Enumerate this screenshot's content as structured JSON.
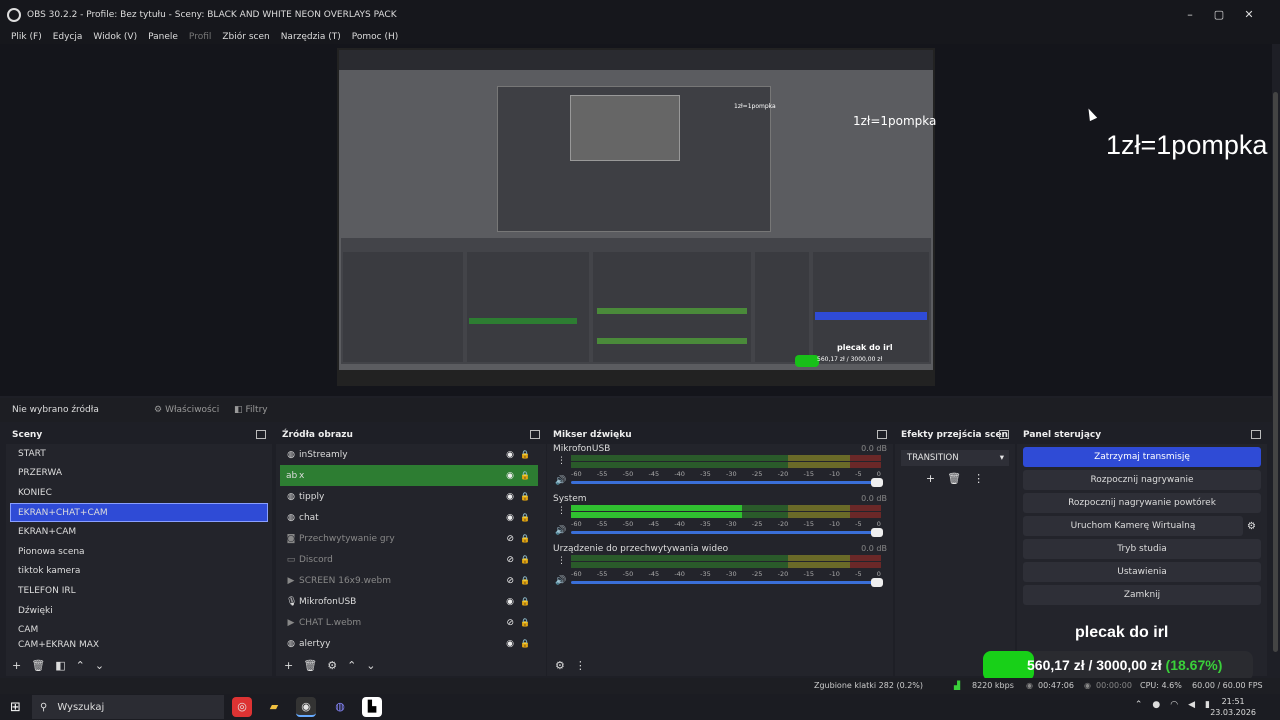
{
  "window": {
    "title": "OBS 30.2.2 - Profile: Bez tytułu - Sceny: BLACK AND WHITE NEON OVERLAYS PACK"
  },
  "menu": [
    "Plik (F)",
    "Edycja",
    "Widok (V)",
    "Panele",
    "Profil",
    "Zbiór scen",
    "Narzędzia (T)",
    "Pomoc (H)"
  ],
  "overlay": {
    "pompka": "1zł=1pompka",
    "plecak": "plecak do irl",
    "goal_amount": "560,17 zł / 3000,00 zł",
    "goal_pct": "(18.67%)",
    "goal_progress": 0.1867
  },
  "source_bar": {
    "no_source": "Nie wybrano źródła",
    "properties": "Właściwości",
    "filters": "Filtry"
  },
  "scenes": {
    "title": "Sceny",
    "items": [
      "START",
      "PRZERWA",
      "KONIEC",
      "EKRAN+CHAT+CAM",
      "EKRAN+CAM",
      "Pionowa scena",
      "tiktok kamera",
      "TELEFON IRL",
      "Dźwięki",
      "CAM",
      "CAM+EKRAN MAX"
    ],
    "selected": "EKRAN+CHAT+CAM"
  },
  "sources": {
    "title": "Źródła obrazu",
    "items": [
      {
        "name": "inStreamly",
        "icon": "globe-icon",
        "visible": true
      },
      {
        "name": "x",
        "icon": "text-icon",
        "visible": true,
        "selected": true
      },
      {
        "name": "tipply",
        "icon": "globe-icon",
        "visible": true
      },
      {
        "name": "chat",
        "icon": "globe-icon",
        "visible": true
      },
      {
        "name": "Przechwytywanie gry",
        "icon": "gamepad-icon",
        "visible": false
      },
      {
        "name": "Discord",
        "icon": "window-icon",
        "visible": false
      },
      {
        "name": "SCREEN 16x9.webm",
        "icon": "play-icon",
        "visible": false
      },
      {
        "name": "MikrofonUSB",
        "icon": "mic-icon",
        "visible": true
      },
      {
        "name": "CHAT L.webm",
        "icon": "play-icon",
        "visible": false
      },
      {
        "name": "alertyy",
        "icon": "globe-icon",
        "visible": true
      }
    ]
  },
  "mixer": {
    "title": "Mikser dźwięku",
    "scale": [
      "-60",
      "-55",
      "-50",
      "-45",
      "-40",
      "-35",
      "-30",
      "-25",
      "-20",
      "-15",
      "-10",
      "-5",
      "0"
    ],
    "channels": [
      {
        "name": "MikrofonUSB",
        "db": "0.0 dB",
        "level": 0
      },
      {
        "name": "System",
        "db": "0.0 dB",
        "level": 0.55
      },
      {
        "name": "Urządzenie do przechwytywania wideo",
        "db": "0.0 dB",
        "level": 0
      }
    ]
  },
  "transitions": {
    "title": "Efekty przejścia scen",
    "selected": "TRANSITION"
  },
  "controls": {
    "title": "Panel sterujący",
    "buttons": [
      "Zatrzymaj transmisję",
      "Rozpocznij nagrywanie",
      "Rozpocznij nagrywanie powtórek",
      "Uruchom Kamerę Wirtualną",
      "Tryb studia",
      "Ustawienia",
      "Zamknij"
    ]
  },
  "status": {
    "dropped": "Zgubione klatki 282 (0.2%)",
    "kbps": "8220 kbps",
    "live_time": "00:47:06",
    "rec_time": "00:00:00",
    "cpu": "CPU: 4.6%",
    "fps": "60.00 / 60.00 FPS"
  },
  "taskbar": {
    "search": "Wyszukaj",
    "time": "21:51",
    "date": "23.03.2026"
  },
  "colors": {
    "accent": "#2f4bd6",
    "selected_source": "#2d7d32",
    "goal": "#18d018"
  }
}
